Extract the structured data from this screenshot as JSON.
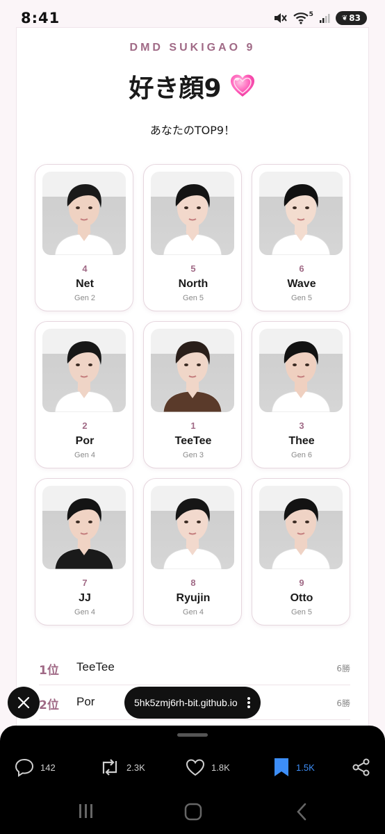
{
  "status_bar": {
    "time": "8:41",
    "battery": "83",
    "signal_badge": "5"
  },
  "page": {
    "eyebrow": "DMD SUKIGAO 9",
    "title": "好き顔9",
    "subtitle": "あなたのTOP9！"
  },
  "members": [
    {
      "rank": "4",
      "name": "Net",
      "gen": "Gen 2",
      "hair": "#1a1a1a",
      "skin": "#efd2c2",
      "shirt": "#ffffff"
    },
    {
      "rank": "5",
      "name": "North",
      "gen": "Gen 5",
      "hair": "#141414",
      "skin": "#f2d8cb",
      "shirt": "#ffffff"
    },
    {
      "rank": "6",
      "name": "Wave",
      "gen": "Gen 5",
      "hair": "#111111",
      "skin": "#f3dccf",
      "shirt": "#ffffff"
    },
    {
      "rank": "2",
      "name": "Por",
      "gen": "Gen 4",
      "hair": "#171717",
      "skin": "#efd4c6",
      "shirt": "#ffffff"
    },
    {
      "rank": "1",
      "name": "TeeTee",
      "gen": "Gen 3",
      "hair": "#2a1f1a",
      "skin": "#f0d6c8",
      "shirt": "#5a3a2a"
    },
    {
      "rank": "3",
      "name": "Thee",
      "gen": "Gen 6",
      "hair": "#121212",
      "skin": "#efd0c0",
      "shirt": "#ffffff"
    },
    {
      "rank": "7",
      "name": "JJ",
      "gen": "Gen 4",
      "hair": "#141414",
      "skin": "#f0d3c4",
      "shirt": "#1a1a1a"
    },
    {
      "rank": "8",
      "name": "Ryujin",
      "gen": "Gen 4",
      "hair": "#161616",
      "skin": "#f2d9cd",
      "shirt": "#ffffff"
    },
    {
      "rank": "9",
      "name": "Otto",
      "gen": "Gen 5",
      "hair": "#131313",
      "skin": "#efd3c5",
      "shirt": "#ffffff"
    }
  ],
  "ranking": [
    {
      "pos": "1位",
      "name": "TeeTee",
      "wins": "6勝"
    },
    {
      "pos": "2位",
      "name": "Por",
      "wins": "6勝"
    }
  ],
  "overlay": {
    "url": "5hk5zmj6rh-bit.github.io"
  },
  "actions": {
    "replies": "142",
    "reposts": "2.3K",
    "likes": "1.8K",
    "bookmarks": "1.5K"
  },
  "colors": {
    "accent": "#a06a86",
    "bookmark_blue": "#3d8ef8"
  }
}
